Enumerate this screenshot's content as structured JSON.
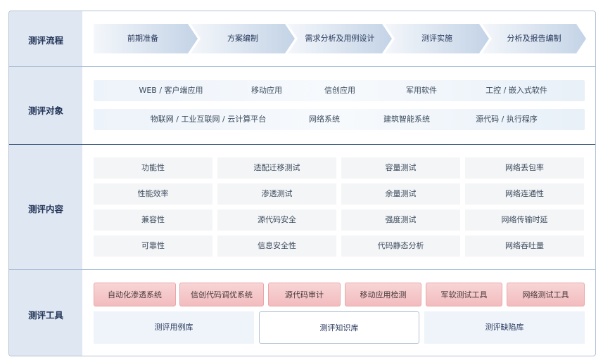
{
  "rows": {
    "process": "测评流程",
    "objects": "测评对象",
    "content": "测评内容",
    "tools": "测评工具"
  },
  "process_steps": [
    "前期准备",
    "方案编制",
    "需求分析及用例设计",
    "测评实施",
    "分析及报告编制"
  ],
  "objects": {
    "line1": [
      "WEB / 客户端应用",
      "移动应用",
      "信创应用",
      "军用软件",
      "工控 / 嵌入式软件"
    ],
    "line2": [
      "物联网 / 工业互联网 / 云计算平台",
      "网络系统",
      "建筑智能系统",
      "源代码 / 执行程序"
    ]
  },
  "content_grid": [
    [
      "功能性",
      "适配迁移测试",
      "容量测试",
      "网络丢包率"
    ],
    [
      "性能效率",
      "渗透测试",
      "余量测试",
      "网络连通性"
    ],
    [
      "兼容性",
      "源代码安全",
      "强度测试",
      "网络传输时延"
    ],
    [
      "可靠性",
      "信息安全性",
      "代码静态分析",
      "网络吞吐量"
    ]
  ],
  "tools": [
    "自动化渗透系统",
    "信创代码调优系统",
    "源代码审计",
    "移动应用检测",
    "军软测试工具",
    "网络测试工具"
  ],
  "libraries": [
    "测评用例库",
    "测评知识库",
    "测评缺陷库"
  ],
  "colors": {
    "chevron_light": "#f4f7fb",
    "chevron_dark": "#c3d3e6",
    "tool_pill": "#f2bcbe",
    "accent_line": "#3d5a7d"
  }
}
